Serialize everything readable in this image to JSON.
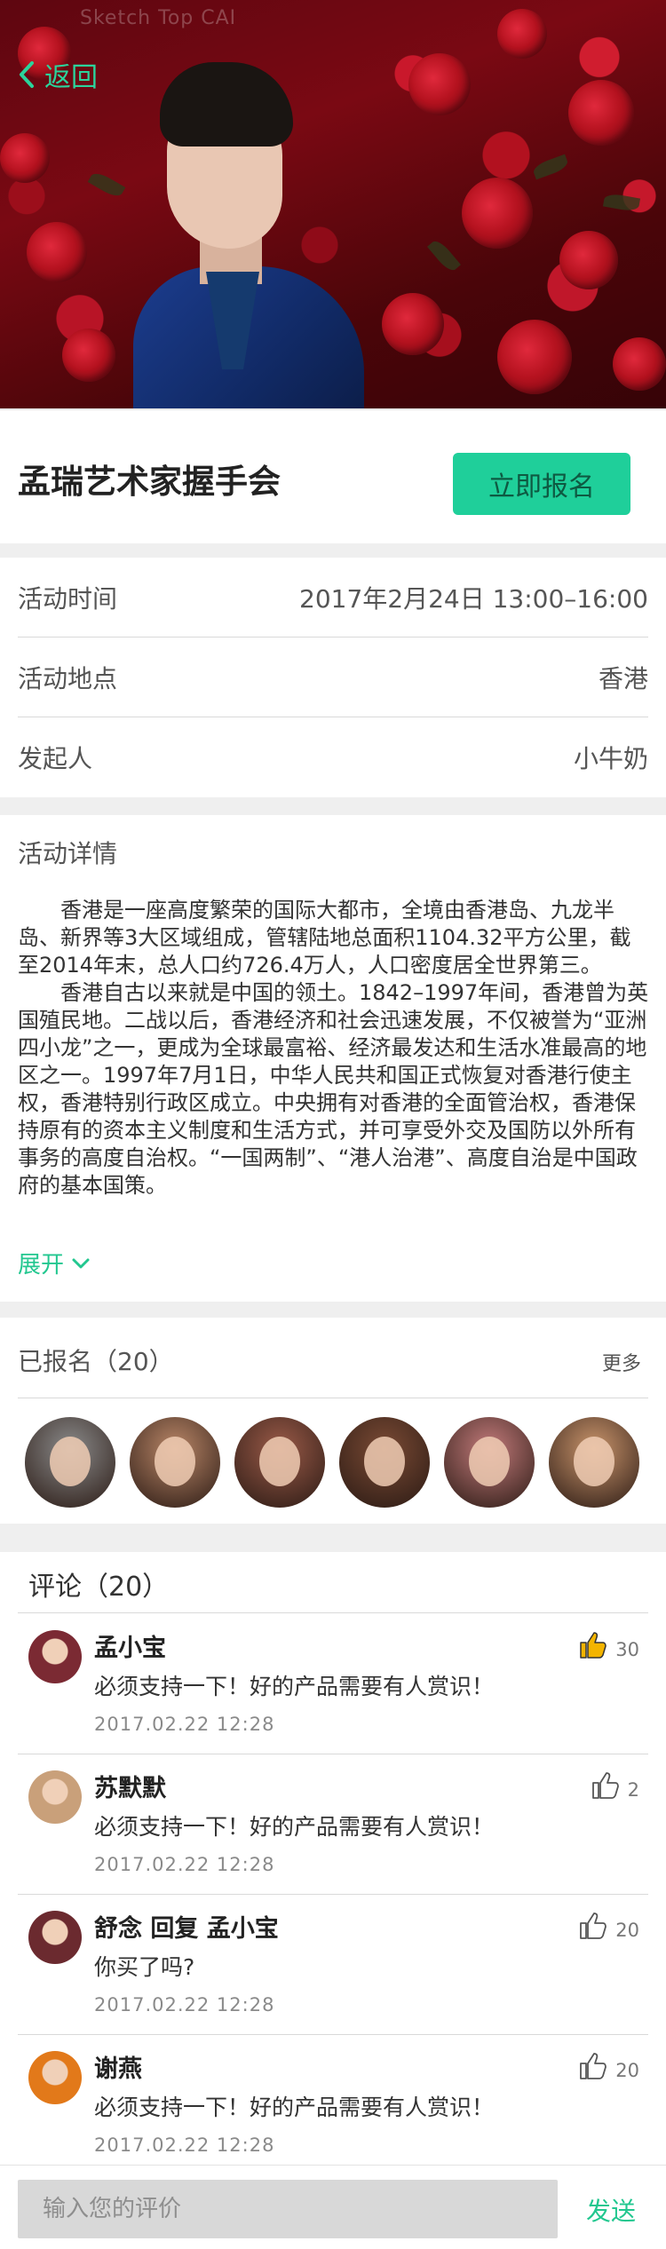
{
  "header": {
    "back_label": "返回",
    "status_text": "Sketch Top CAI"
  },
  "event": {
    "title": "孟瑞艺术家握手会",
    "signup_label": "立即报名"
  },
  "info": [
    {
      "label": "活动时间",
      "value": "2017年2月24日  13:00–16:00"
    },
    {
      "label": "活动地点",
      "value": "香港"
    },
    {
      "label": "发起人",
      "value": "小牛奶"
    }
  ],
  "details": {
    "heading": "活动详情",
    "paragraph_1": "香港是一座高度繁荣的国际大都市，全境由香港岛、九龙半岛、新界等3大区域组成，管辖陆地总面积1104.32平方公里，截至2014年末，总人口约726.4万人，人口密度居全世界第三。",
    "paragraph_2": "香港自古以来就是中国的领土。1842–1997年间，香港曾为英国殖民地。二战以后，香港经济和社会迅速发展，不仅被誉为“亚洲四小龙”之一，更成为全球最富裕、经济最发达和生活水准最高的地区之一。1997年7月1日，中华人民共和国正式恢复对香港行使主权，香港特别行政区成立。中央拥有对香港的全面管治权，香港保持原有的资本主义制度和生活方式，并可享受外交及国防以外所有事务的高度自治权。“一国两制”、“港人治港”、高度自治是中国政府的基本国策。",
    "expand_label": "展开"
  },
  "signed_up": {
    "title": "已报名（20）",
    "more_label": "更多",
    "avatar_colors": [
      "#8a8a8a",
      "#b98667",
      "#9a5a48",
      "#7a4a34",
      "#c27a7a",
      "#c9946b"
    ]
  },
  "comments": {
    "title": "评论（20）",
    "items": [
      {
        "name": "孟小宝",
        "text": "必须支持一下！好的产品需要有人赏识！",
        "time": "2017.02.22   12:28",
        "likes": "30",
        "liked": true,
        "avatar_color": "#7b2a33"
      },
      {
        "name": "苏默默",
        "text": "必须支持一下！好的产品需要有人赏识！",
        "time": "2017.02.22   12:28",
        "likes": "2",
        "liked": false,
        "avatar_color": "#c9a07a"
      },
      {
        "name": "舒念   回复   孟小宝",
        "text": "你买了吗?",
        "time": "2017.02.22   12:28",
        "likes": "20",
        "liked": false,
        "avatar_color": "#6b2a2f"
      },
      {
        "name": "谢燕",
        "text": "必须支持一下！好的产品需要有人赏识！",
        "time": "2017.02.22   12:28",
        "likes": "20",
        "liked": false,
        "avatar_color": "#e2791a"
      }
    ]
  },
  "comment_input": {
    "placeholder": "输入您的评价",
    "send_label": "发送"
  },
  "colors": {
    "accent": "#1fcf9a",
    "accent_text": "#22c78f",
    "like_active": "#f3b400"
  }
}
